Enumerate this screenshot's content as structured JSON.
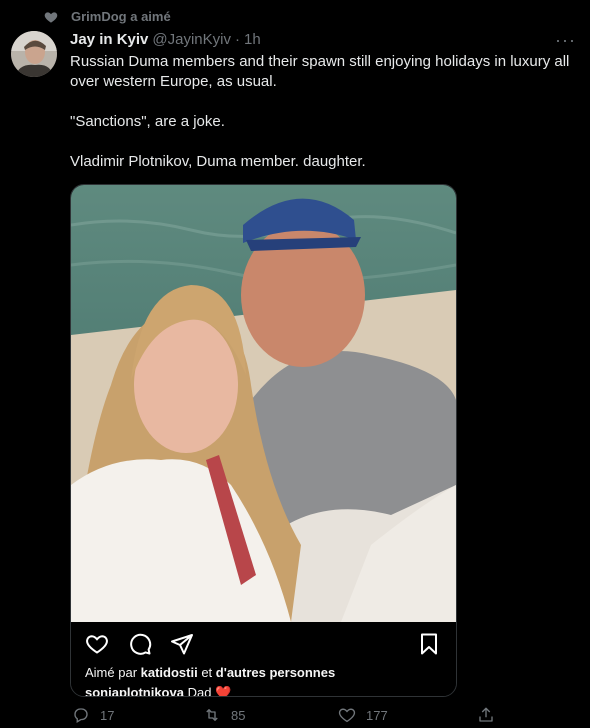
{
  "context": {
    "text": "GrimDog a aimé",
    "icon": "heart-icon"
  },
  "author": {
    "name": "Jay in Kyiv",
    "handle": "@JayinKyiv",
    "separator": "·",
    "time": "1h"
  },
  "more_label": "···",
  "body": {
    "p1": "Russian Duma members and their spawn still enjoying holidays in luxury all over western Europe, as usual.",
    "p2": "\"Sanctions\", are a joke.",
    "p3": "Vladimir Plotnikov, Duma member. daughter."
  },
  "instagram": {
    "likes_prefix": "Aimé par ",
    "liker": "katidostii",
    "likes_mid": " et ",
    "likes_rest": "d'autres personnes",
    "caption_user": "sonjaplotnikova",
    "caption_text": " Dad ",
    "caption_emoji": "❤️"
  },
  "actions": {
    "reply_count": "17",
    "retweet_count": "85",
    "like_count": "177"
  },
  "colors": {
    "background": "#000000",
    "text": "#e7e9ea",
    "secondary": "#71767b",
    "heart_emoji": "#e0245e"
  }
}
